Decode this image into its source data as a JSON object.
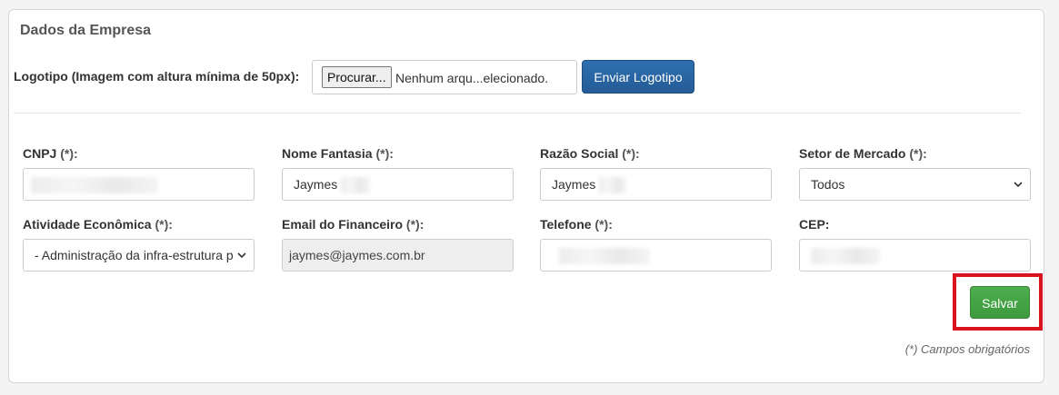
{
  "panel": {
    "title": "Dados da Empresa"
  },
  "logo": {
    "label": "Logotipo (Imagem com altura mínima de 50px):",
    "browse_label": "Procurar...",
    "file_status": "Nenhum arqu...elecionado.",
    "send_label": "Enviar Logotipo"
  },
  "fields": {
    "cnpj": {
      "label": "CNPJ",
      "req": "(*):",
      "value": ""
    },
    "nome_fantasia": {
      "label": "Nome Fantasia",
      "req": "(*):",
      "value": "Jaymes"
    },
    "razao_social": {
      "label": "Razão Social",
      "req": "(*):",
      "value": "Jaymes"
    },
    "setor_mercado": {
      "label": "Setor de Mercado",
      "req": "(*):",
      "value": "Todos"
    },
    "atividade": {
      "label": "Atividade Econômica",
      "req": "(*):",
      "value": "- Administração da infra-estrutura p"
    },
    "email_financeiro": {
      "label": "Email do Financeiro",
      "req": "(*):",
      "value": "jaymes@jaymes.com.br"
    },
    "telefone": {
      "label": "Telefone",
      "req": "(*):",
      "value": ""
    },
    "cep": {
      "label": "CEP:",
      "value": ""
    }
  },
  "actions": {
    "save_label": "Salvar"
  },
  "footer": {
    "required_note": "(*) Campos obrigatórios"
  },
  "colors": {
    "primary": "#2f6fb0",
    "success": "#4cae4c",
    "highlight": "#d9141f"
  }
}
